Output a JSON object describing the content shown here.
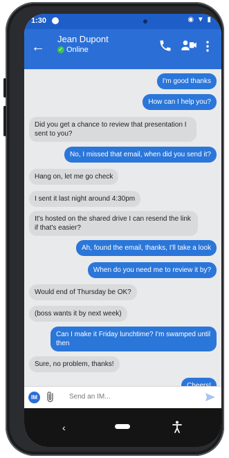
{
  "status_bar": {
    "time": "1:30"
  },
  "header": {
    "contact_name": "Jean Dupont",
    "presence": "Online"
  },
  "messages": [
    {
      "dir": "out",
      "text": "I'm good thanks"
    },
    {
      "dir": "out",
      "text": "How can I help you?"
    },
    {
      "dir": "in",
      "text": "Did you get a chance to review that presentation I sent to you?"
    },
    {
      "dir": "out",
      "text": "No, I missed that email, when did you send it?"
    },
    {
      "dir": "in",
      "text": "Hang on, let me go check"
    },
    {
      "dir": "in",
      "text": "I sent it last night around 4:30pm"
    },
    {
      "dir": "in",
      "text": "It's hosted on the shared drive I can resend the link if that's easier?"
    },
    {
      "dir": "out",
      "text": "Ah, found the email, thanks, I'll take a look"
    },
    {
      "dir": "out",
      "text": "When do you need me to review it by?"
    },
    {
      "dir": "in",
      "text": "Would end of Thursday be OK?"
    },
    {
      "dir": "in",
      "text": "(boss wants it by next week)"
    },
    {
      "dir": "out",
      "text": "Can I make it Friday lunchtime? I'm swamped until then"
    },
    {
      "dir": "in",
      "text": "Sure, no problem, thanks!"
    },
    {
      "dir": "out",
      "text": "Cheers!"
    }
  ],
  "composer": {
    "mode_badge": "IM",
    "placeholder": "Send an IM..."
  },
  "colors": {
    "app_bar": "#2b6fd6",
    "outgoing_bubble": "#2b76d9",
    "incoming_bubble": "#d9dadc",
    "online": "#3cc24a"
  },
  "icons": [
    "back-arrow-icon",
    "check-icon",
    "phone-icon",
    "video-call-icon",
    "more-vert-icon",
    "paperclip-icon",
    "send-icon",
    "accessibility-icon"
  ]
}
